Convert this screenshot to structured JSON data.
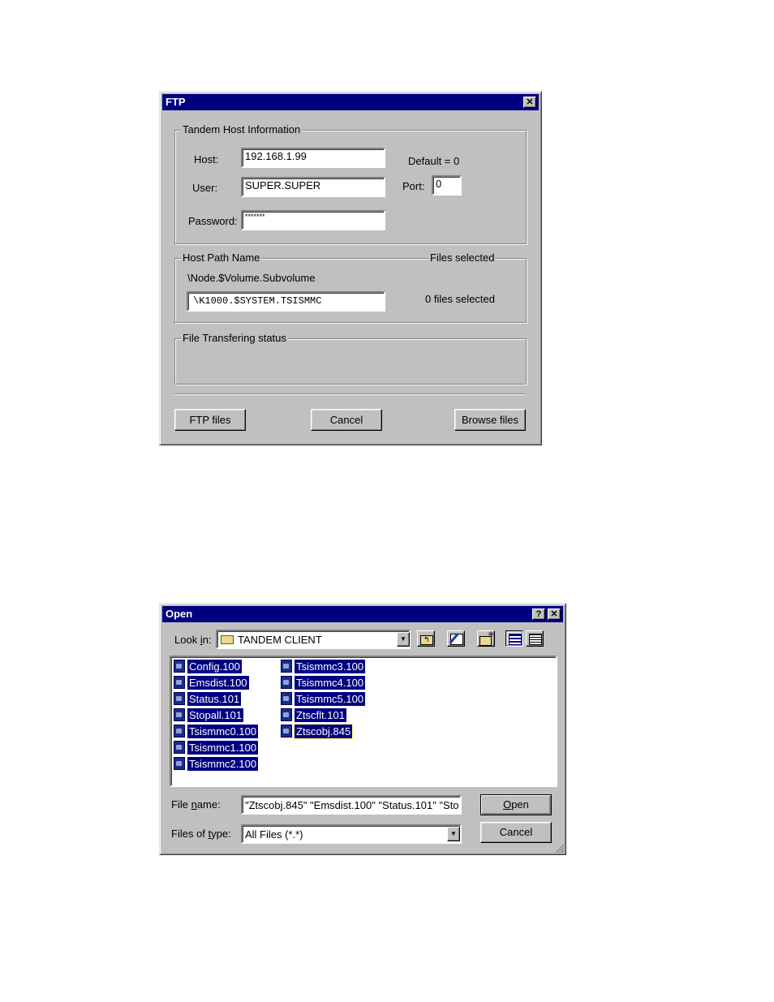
{
  "ftp_dialog": {
    "title": "FTP",
    "close_glyph": "✕",
    "host_info": {
      "group_label": "Tandem Host Information",
      "host_label": "Host:",
      "host_value": "192.168.1.99",
      "user_label": "User:",
      "user_value": "SUPER.SUPER",
      "password_label": "Password:",
      "password_value": "*******",
      "default_note": "Default = 0",
      "port_label": "Port:",
      "port_value": "0"
    },
    "host_path": {
      "group_label": "Host Path Name",
      "format_hint": "\\Node.$Volume.Subvolume",
      "path_value": "\\K1000.$SYSTEM.TSISMMC",
      "files_selected_label": "Files selected",
      "files_selected_value": "0 files selected"
    },
    "status": {
      "group_label": "File Transfering status"
    },
    "buttons": {
      "ftp": "FTP files",
      "cancel": "Cancel",
      "browse": "Browse files"
    }
  },
  "open_dialog": {
    "title": "Open",
    "help_glyph": "?",
    "close_glyph": "✕",
    "look_in_label_a": "Look ",
    "look_in_label_u": "i",
    "look_in_label_b": "n:",
    "look_in_value": "TANDEM CLIENT",
    "toolbar_icons": [
      "up-folder-icon",
      "desktop-icon",
      "new-folder-icon",
      "list-view-icon",
      "details-view-icon"
    ],
    "files_col1": [
      "Config.100",
      "Emsdist.100",
      "Status.101",
      "Stopall.101",
      "Tsismmc0.100",
      "Tsismmc1.100",
      "Tsismmc2.100"
    ],
    "files_col2": [
      "Tsismmc3.100",
      "Tsismmc4.100",
      "Tsismmc5.100",
      "Ztscflt.101",
      "Ztscobj.845"
    ],
    "file_name_label_a": "File ",
    "file_name_label_u": "n",
    "file_name_label_b": "ame:",
    "file_name_value": "\"Ztscobj.845\" \"Emsdist.100\" \"Status.101\" \"Sto",
    "files_of_type_label_a": "Files of ",
    "files_of_type_label_u": "t",
    "files_of_type_label_b": "ype:",
    "files_of_type_value": "All Files (*.*)",
    "open_button_u": "O",
    "open_button_rest": "pen",
    "cancel_button": "Cancel"
  }
}
